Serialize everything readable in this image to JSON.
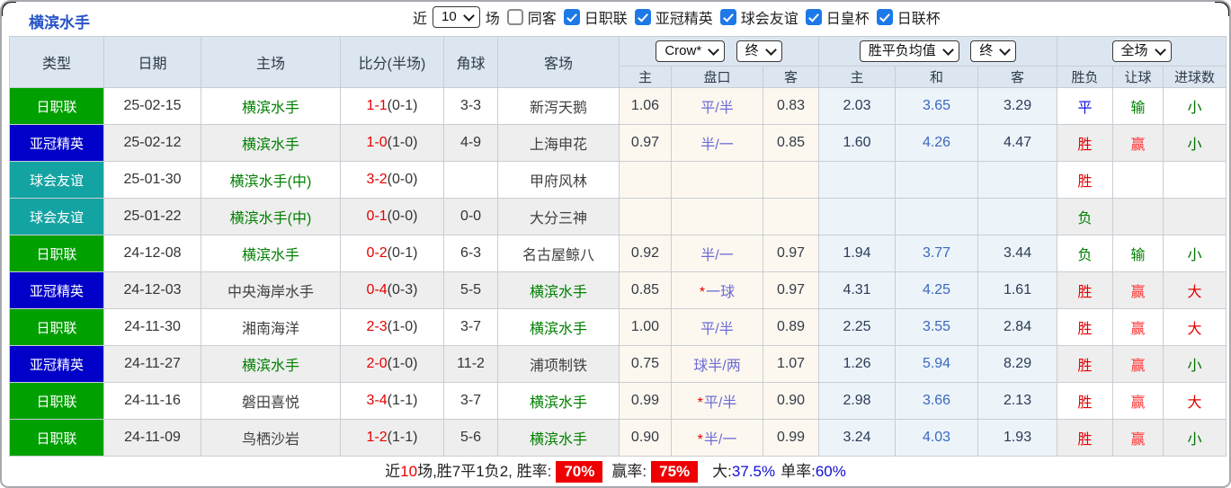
{
  "title": "横滨水手",
  "filter": {
    "near_label": "近",
    "matches_value": "10",
    "matches_label": "场",
    "same_opponent_label": "同客",
    "same_opponent_checked": false,
    "leagues": [
      {
        "label": "日职联",
        "checked": true
      },
      {
        "label": "亚冠精英",
        "checked": true
      },
      {
        "label": "球会友谊",
        "checked": true
      },
      {
        "label": "日皇杯",
        "checked": true
      },
      {
        "label": "日联杯",
        "checked": true
      }
    ]
  },
  "table": {
    "columns": [
      "类型",
      "日期",
      "主场",
      "比分(半场)",
      "角球",
      "客场",
      "主",
      "盘口",
      "客",
      "主",
      "和",
      "客",
      "胜负",
      "让球",
      "进球数"
    ],
    "selects": {
      "odds_source": "Crow*",
      "odds_time": "终",
      "avg_source": "胜平负均值",
      "avg_time": "终",
      "scope": "全场"
    },
    "rows": [
      {
        "league": "日职联",
        "date": "25-02-15",
        "home": "横滨水手",
        "home_is_subject": true,
        "score": "1-1",
        "half": "(0-1)",
        "corners": "3-3",
        "away": "新泻天鹅",
        "away_is_subject": false,
        "odds_home": "1.06",
        "handicap_star": false,
        "handicap": "平/半",
        "odds_away": "0.83",
        "avg_home": "2.03",
        "avg_draw": "3.65",
        "avg_away": "3.29",
        "outcome": "平",
        "outcome_key": "draw",
        "handicap_outcome": "输",
        "handicap_outcome_key": "hlose",
        "goals": "小",
        "goals_key": "small"
      },
      {
        "league": "亚冠精英",
        "date": "25-02-12",
        "home": "横滨水手",
        "home_is_subject": true,
        "score": "1-0",
        "half": "(1-0)",
        "corners": "4-9",
        "away": "上海申花",
        "away_is_subject": false,
        "odds_home": "0.97",
        "handicap_star": false,
        "handicap": "半/一",
        "odds_away": "0.85",
        "avg_home": "1.60",
        "avg_draw": "4.26",
        "avg_away": "4.47",
        "outcome": "胜",
        "outcome_key": "win",
        "handicap_outcome": "赢",
        "handicap_outcome_key": "hwin",
        "goals": "小",
        "goals_key": "small"
      },
      {
        "league": "球会友谊",
        "date": "25-01-30",
        "home": "横滨水手(中)",
        "home_is_subject": true,
        "score": "3-2",
        "half": "(0-0)",
        "corners": "",
        "away": "甲府风林",
        "away_is_subject": false,
        "odds_home": "",
        "handicap_star": false,
        "handicap": "",
        "odds_away": "",
        "avg_home": "",
        "avg_draw": "",
        "avg_away": "",
        "outcome": "胜",
        "outcome_key": "win",
        "handicap_outcome": "",
        "handicap_outcome_key": "",
        "goals": "",
        "goals_key": ""
      },
      {
        "league": "球会友谊",
        "date": "25-01-22",
        "home": "横滨水手(中)",
        "home_is_subject": true,
        "score": "0-1",
        "half": "(0-0)",
        "corners": "0-0",
        "away": "大分三神",
        "away_is_subject": false,
        "odds_home": "",
        "handicap_star": false,
        "handicap": "",
        "odds_away": "",
        "avg_home": "",
        "avg_draw": "",
        "avg_away": "",
        "outcome": "负",
        "outcome_key": "loss",
        "handicap_outcome": "",
        "handicap_outcome_key": "",
        "goals": "",
        "goals_key": ""
      },
      {
        "league": "日职联",
        "date": "24-12-08",
        "home": "横滨水手",
        "home_is_subject": true,
        "score": "0-2",
        "half": "(0-1)",
        "corners": "6-3",
        "away": "名古屋鲸八",
        "away_is_subject": false,
        "odds_home": "0.92",
        "handicap_star": false,
        "handicap": "半/一",
        "odds_away": "0.97",
        "avg_home": "1.94",
        "avg_draw": "3.77",
        "avg_away": "3.44",
        "outcome": "负",
        "outcome_key": "loss",
        "handicap_outcome": "输",
        "handicap_outcome_key": "hlose",
        "goals": "小",
        "goals_key": "small"
      },
      {
        "league": "亚冠精英",
        "date": "24-12-03",
        "home": "中央海岸水手",
        "home_is_subject": false,
        "score": "0-4",
        "half": "(0-3)",
        "corners": "5-5",
        "away": "横滨水手",
        "away_is_subject": true,
        "odds_home": "0.85",
        "handicap_star": true,
        "handicap": "一球",
        "odds_away": "0.97",
        "avg_home": "4.31",
        "avg_draw": "4.25",
        "avg_away": "1.61",
        "outcome": "胜",
        "outcome_key": "win",
        "handicap_outcome": "赢",
        "handicap_outcome_key": "hwin",
        "goals": "大",
        "goals_key": "big"
      },
      {
        "league": "日职联",
        "date": "24-11-30",
        "home": "湘南海洋",
        "home_is_subject": false,
        "score": "2-3",
        "half": "(1-0)",
        "corners": "3-7",
        "away": "横滨水手",
        "away_is_subject": true,
        "odds_home": "1.00",
        "handicap_star": false,
        "handicap": "平/半",
        "odds_away": "0.89",
        "avg_home": "2.25",
        "avg_draw": "3.55",
        "avg_away": "2.84",
        "outcome": "胜",
        "outcome_key": "win",
        "handicap_outcome": "赢",
        "handicap_outcome_key": "hwin",
        "goals": "大",
        "goals_key": "big"
      },
      {
        "league": "亚冠精英",
        "date": "24-11-27",
        "home": "横滨水手",
        "home_is_subject": true,
        "score": "2-0",
        "half": "(1-0)",
        "corners": "11-2",
        "away": "浦项制铁",
        "away_is_subject": false,
        "odds_home": "0.75",
        "handicap_star": false,
        "handicap": "球半/两",
        "odds_away": "1.07",
        "avg_home": "1.26",
        "avg_draw": "5.94",
        "avg_away": "8.29",
        "outcome": "胜",
        "outcome_key": "win",
        "handicap_outcome": "赢",
        "handicap_outcome_key": "hwin",
        "goals": "小",
        "goals_key": "small"
      },
      {
        "league": "日职联",
        "date": "24-11-16",
        "home": "磐田喜悦",
        "home_is_subject": false,
        "score": "3-4",
        "half": "(1-1)",
        "corners": "3-7",
        "away": "横滨水手",
        "away_is_subject": true,
        "odds_home": "0.99",
        "handicap_star": true,
        "handicap": "平/半",
        "odds_away": "0.90",
        "avg_home": "2.98",
        "avg_draw": "3.66",
        "avg_away": "2.13",
        "outcome": "胜",
        "outcome_key": "win",
        "handicap_outcome": "赢",
        "handicap_outcome_key": "hwin",
        "goals": "大",
        "goals_key": "big"
      },
      {
        "league": "日职联",
        "date": "24-11-09",
        "home": "鸟栖沙岩",
        "home_is_subject": false,
        "score": "1-2",
        "half": "(1-1)",
        "corners": "5-6",
        "away": "横滨水手",
        "away_is_subject": true,
        "odds_home": "0.90",
        "handicap_star": true,
        "handicap": "半/一",
        "odds_away": "0.99",
        "avg_home": "3.24",
        "avg_draw": "4.03",
        "avg_away": "1.93",
        "outcome": "胜",
        "outcome_key": "win",
        "handicap_outcome": "赢",
        "handicap_outcome_key": "hwin",
        "goals": "小",
        "goals_key": "small"
      }
    ]
  },
  "footer": {
    "p1": "近",
    "count": "10",
    "p2": "场,胜7平1负2, 胜率:",
    "win_rate": "70%",
    "p3": "赢率:",
    "handicap_rate": "75%",
    "p4": "大:",
    "big_rate": "37.5%",
    "p5": "单率:",
    "single_rate": "60%"
  },
  "colors": {
    "leagues": {
      "日职联": "#00A000",
      "亚冠精英": "#0000C8",
      "球会友谊": "#14A3A3"
    },
    "subject_team": "#008000",
    "score_red": "#E60000",
    "badge_red": "#EE0000",
    "title_blue": "#2653C9"
  }
}
